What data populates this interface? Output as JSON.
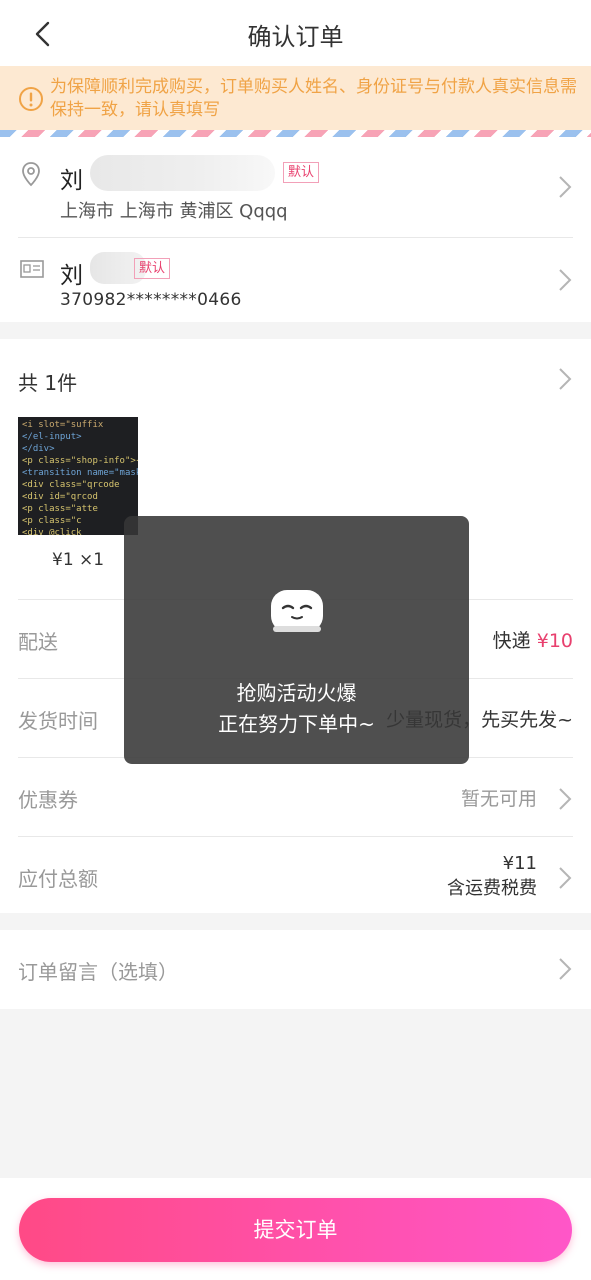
{
  "header": {
    "title": "确认订单"
  },
  "notice": {
    "text": "为保障顺利完成购买，订单购买人姓名、身份证号与付款人真实信息需保持一致，请认真填写"
  },
  "address": {
    "name": "刘",
    "tag": "默认",
    "detail": "上海市 上海市 黄浦区 Qqqq"
  },
  "identity": {
    "name": "刘",
    "tag": "默认",
    "id_number": "370982********0466"
  },
  "goods": {
    "count_label": "共 1件",
    "price_qty": "¥1  ×1",
    "code_lines": [
      "      <i slot=\"suffix",
      "    </el-input>",
      "  </div>",
      "<p class=\"shop-info\">{",
      "<transition name=\"mask",
      "  <div class=\"qrcode",
      "    <div id=\"qrcod",
      "    <p class=\"atte",
      "    <p class=\"c",
      "    <div @click"
    ]
  },
  "delivery": {
    "label": "配送",
    "method": "快递",
    "fee": "¥10"
  },
  "ship_time": {
    "label": "发货时间",
    "value": "少量现货，先买先发~"
  },
  "coupon": {
    "label": "优惠券",
    "value": "暂无可用"
  },
  "total": {
    "label": "应付总额",
    "amount": "¥11",
    "note": "含运费税费"
  },
  "remark": {
    "label": "订单留言（选填）"
  },
  "footer": {
    "submit_label": "提交订单"
  },
  "toast": {
    "line1": "抢购活动火爆",
    "line2": "正在努力下单中~"
  },
  "colors": {
    "accent": "#e8406e",
    "notice_text": "#f0a346",
    "notice_bg": "#fde9d2"
  }
}
